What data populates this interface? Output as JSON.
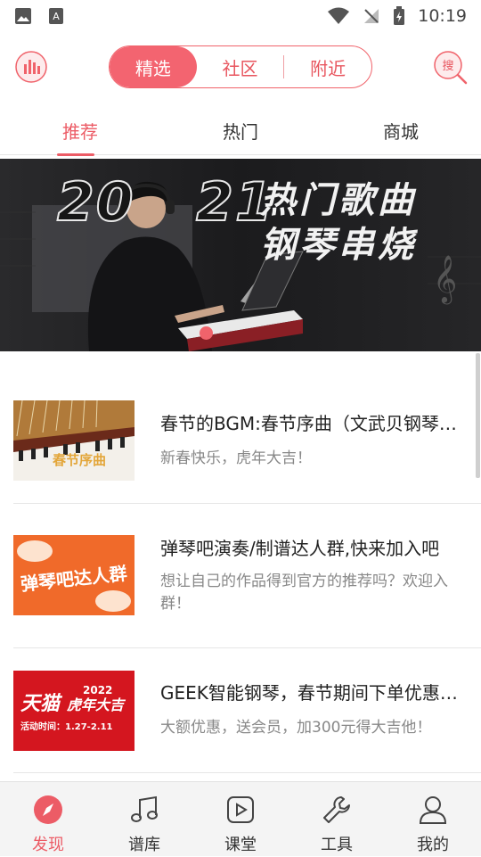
{
  "status": {
    "time": "10:19"
  },
  "segments": [
    {
      "label": "精选",
      "selected": true
    },
    {
      "label": "社区",
      "selected": false
    },
    {
      "label": "附近",
      "selected": false
    }
  ],
  "search_icon_text": "搜",
  "tabs": [
    {
      "label": "推荐",
      "active": true
    },
    {
      "label": "热门",
      "active": false
    },
    {
      "label": "商城",
      "active": false
    }
  ],
  "banner": {
    "year_left": "20",
    "year_right": "21",
    "line1": "热门歌曲",
    "line2": "钢琴串烧"
  },
  "feed": [
    {
      "title": "春节的BGM:春节序曲（文武贝钢琴版）",
      "subtitle": "新春快乐，虎年大吉！",
      "thumb_text": "春节序曲"
    },
    {
      "title": "弹琴吧演奏/制谱达人群,快来加入吧",
      "subtitle": "想让自己的作品得到官方的推荐吗？欢迎入群！",
      "thumb_text": "弹琴吧达人群"
    },
    {
      "title": "GEEK智能钢琴，春节期间下单优惠活动",
      "subtitle": "大额优惠，送会员，加300元得大吉他！",
      "thumb_text_1": "天猫",
      "thumb_text_2": "2022",
      "thumb_text_3": "虎年大吉",
      "thumb_text_4": "活动时间：1.27-2.11"
    }
  ],
  "nav": [
    {
      "label": "发现",
      "icon": "compass-icon",
      "active": true
    },
    {
      "label": "谱库",
      "icon": "music-note-icon",
      "active": false
    },
    {
      "label": "课堂",
      "icon": "play-icon",
      "active": false
    },
    {
      "label": "工具",
      "icon": "wrench-icon",
      "active": false
    },
    {
      "label": "我的",
      "icon": "user-icon",
      "active": false
    }
  ],
  "colors": {
    "accent": "#ec5c66"
  }
}
